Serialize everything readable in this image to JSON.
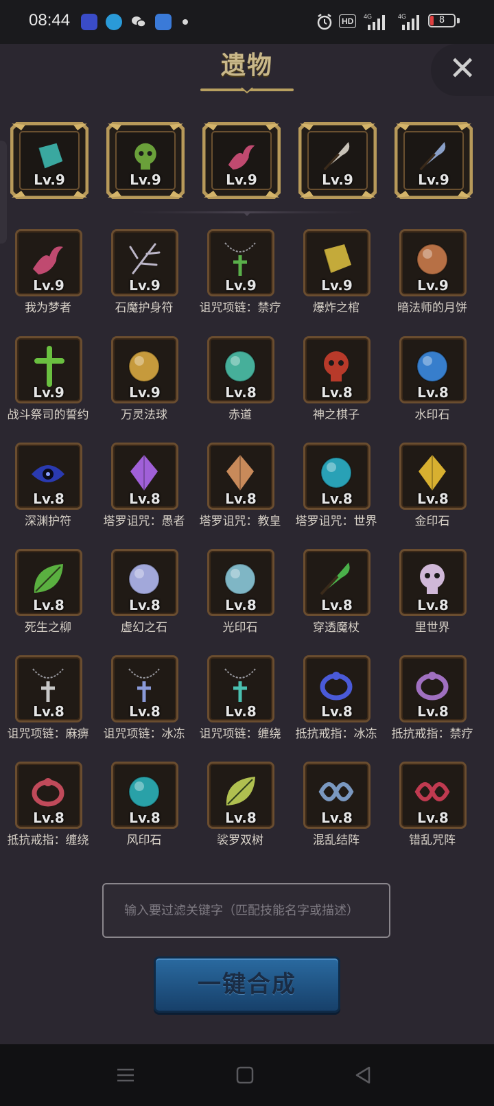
{
  "status_bar": {
    "time": "08:44",
    "app_icons": [
      "tieba-icon",
      "telegram-icon",
      "wechat-icon",
      "app-icon"
    ],
    "indicators": [
      "alarm-icon",
      "HD",
      "4G",
      "4G"
    ],
    "battery": "8"
  },
  "header": {
    "title": "遗物",
    "close_icon": "close-icon"
  },
  "equipped": [
    {
      "level": "Lv.9",
      "icon": "cube-relic-icon",
      "color": "#3aa8a0"
    },
    {
      "level": "Lv.9",
      "icon": "goblin-head-icon",
      "color": "#6aa03a"
    },
    {
      "level": "Lv.9",
      "icon": "dreamer-relic-icon",
      "color": "#c04a70"
    },
    {
      "level": "Lv.9",
      "icon": "blade-relic-icon",
      "color": "#c8c2b8"
    },
    {
      "level": "Lv.9",
      "icon": "scythe-relic-icon",
      "color": "#8aa0c8"
    }
  ],
  "relics": [
    {
      "name": "我为梦者",
      "level": "Lv.9",
      "icon": "dreamer-icon",
      "color": "#c04a70"
    },
    {
      "name": "石魔护身符",
      "level": "Lv.9",
      "icon": "bone-amulet-icon",
      "color": "#bcb6c8"
    },
    {
      "name": "诅咒项链：禁疗",
      "level": "Lv.9",
      "icon": "green-necklace-icon",
      "color": "#5ab04a"
    },
    {
      "name": "爆炸之棺",
      "level": "Lv.9",
      "icon": "coffin-icon",
      "color": "#c4aa3a"
    },
    {
      "name": "暗法师的月饼",
      "level": "Lv.9",
      "icon": "mooncake-icon",
      "color": "#c87a4a"
    },
    {
      "name": "战斗祭司的誓约",
      "level": "Lv.9",
      "icon": "green-cross-icon",
      "color": "#6ac040"
    },
    {
      "name": "万灵法球",
      "level": "Lv.9",
      "icon": "golden-orb-icon",
      "color": "#d8a840"
    },
    {
      "name": "赤道",
      "level": "Lv.8",
      "icon": "teal-orb-icon",
      "color": "#4ac0a8"
    },
    {
      "name": "神之棋子",
      "level": "Lv.8",
      "icon": "chess-piece-icon",
      "color": "#b83a2a"
    },
    {
      "name": "水印石",
      "level": "Lv.8",
      "icon": "water-stone-icon",
      "color": "#3a8ae0"
    },
    {
      "name": "深渊护符",
      "level": "Lv.8",
      "icon": "abyss-eye-icon",
      "color": "#2a3ab0"
    },
    {
      "name": "塔罗诅咒：愚者",
      "level": "Lv.8",
      "icon": "tarot-fool-icon",
      "color": "#a060d8"
    },
    {
      "name": "塔罗诅咒：教皇",
      "level": "Lv.8",
      "icon": "tarot-pope-icon",
      "color": "#c88a5a"
    },
    {
      "name": "塔罗诅咒：世界",
      "level": "Lv.8",
      "icon": "world-orb-icon",
      "color": "#2ab0c8"
    },
    {
      "name": "金印石",
      "level": "Lv.8",
      "icon": "gold-crystal-icon",
      "color": "#d8b030"
    },
    {
      "name": "死生之柳",
      "level": "Lv.8",
      "icon": "willow-icon",
      "color": "#5ab040"
    },
    {
      "name": "虚幻之石",
      "level": "Lv.8",
      "icon": "illusion-stone-icon",
      "color": "#b0b8f0"
    },
    {
      "name": "光印石",
      "level": "Lv.8",
      "icon": "light-stone-icon",
      "color": "#8ac8d8"
    },
    {
      "name": "穿透魔杖",
      "level": "Lv.8",
      "icon": "wand-icon",
      "color": "#4ab04a"
    },
    {
      "name": "里世界",
      "level": "Lv.8",
      "icon": "skull-icon",
      "color": "#d0b8d8"
    },
    {
      "name": "诅咒项链：麻痹",
      "level": "Lv.8",
      "icon": "cross-necklace-icon",
      "color": "#c8c8c8"
    },
    {
      "name": "诅咒项链：冰冻",
      "level": "Lv.8",
      "icon": "ice-necklace-icon",
      "color": "#8a9ad8"
    },
    {
      "name": "诅咒项链：缠绕",
      "level": "Lv.8",
      "icon": "teal-necklace-icon",
      "color": "#4ac0b0"
    },
    {
      "name": "抵抗戒指：冰冻",
      "level": "Lv.8",
      "icon": "blue-ring-icon",
      "color": "#4a5ad8"
    },
    {
      "name": "抵抗戒指：禁疗",
      "level": "Lv.8",
      "icon": "purple-ring-icon",
      "color": "#a070c0"
    },
    {
      "name": "抵抗戒指：缠绕",
      "level": "Lv.8",
      "icon": "red-ring-icon",
      "color": "#c04a5a"
    },
    {
      "name": "风印石",
      "level": "Lv.8",
      "icon": "wind-stone-icon",
      "color": "#2ab0b8"
    },
    {
      "name": "裟罗双树",
      "level": "Lv.8",
      "icon": "leaf-icon",
      "color": "#b0c050"
    },
    {
      "name": "混乱结阵",
      "level": "Lv.8",
      "icon": "chaos-array-icon",
      "color": "#7a98c0"
    },
    {
      "name": "错乱咒阵",
      "level": "Lv.8",
      "icon": "rope-knot-icon",
      "color": "#c03a50"
    }
  ],
  "filter": {
    "placeholder": "输入要过滤关键字（匹配技能名字或描述）"
  },
  "merge_button": {
    "label": "一键合成"
  },
  "nav_bar": [
    "menu-icon",
    "home-icon",
    "back-icon"
  ]
}
